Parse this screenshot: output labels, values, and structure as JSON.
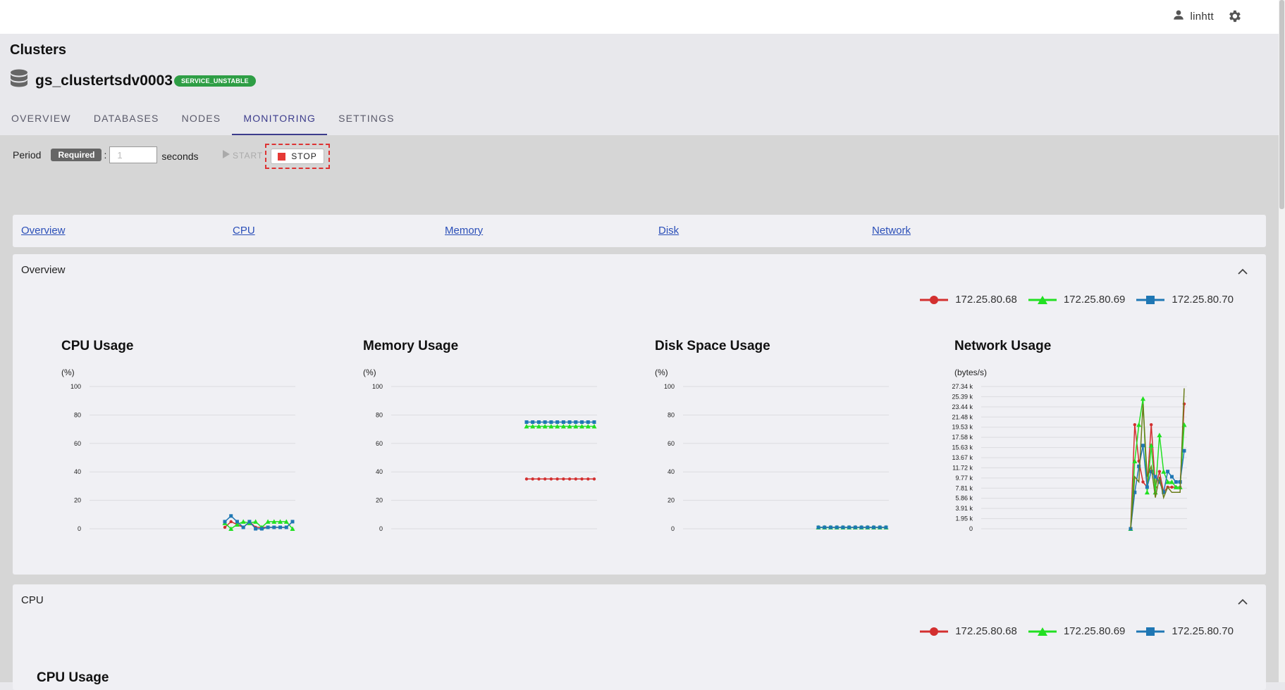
{
  "header": {
    "username": "linhtt",
    "user_icon": "person-icon",
    "settings_icon": "gear-icon"
  },
  "page_title": "Clusters",
  "cluster": {
    "name": "gs_clustertsdv0003",
    "status": "SERVICE_UNSTABLE",
    "icon": "database-icon",
    "status_color": "#2e9e45"
  },
  "tabs": [
    {
      "label": "OVERVIEW"
    },
    {
      "label": "DATABASES"
    },
    {
      "label": "NODES"
    },
    {
      "label": "MONITORING",
      "active": true
    },
    {
      "label": "SETTINGS"
    }
  ],
  "controls": {
    "period_label": "Period",
    "required_badge": "Required",
    "colon": ":",
    "period_value": "1",
    "seconds_label": "seconds",
    "start_label": "START",
    "stop_label": "STOP"
  },
  "nav_links": [
    "Overview",
    "CPU",
    "Memory",
    "Disk",
    "Network"
  ],
  "sections": {
    "overview_title": "Overview",
    "cpu_title": "CPU",
    "cpu_chart_title": "CPU Usage"
  },
  "legend": [
    {
      "label": "172.25.80.68",
      "color": "#d32f2f",
      "marker": "circle"
    },
    {
      "label": "172.25.80.69",
      "color": "#22e022",
      "marker": "triangle"
    },
    {
      "label": "172.25.80.70",
      "color": "#1f77b4",
      "marker": "square"
    }
  ],
  "chart_data": [
    {
      "type": "line",
      "title": "CPU Usage",
      "ylabel": "(%)",
      "ylim": [
        0,
        100
      ],
      "yticks": [
        "100",
        "80",
        "60",
        "40",
        "20",
        "0"
      ],
      "x": [
        1,
        2,
        3,
        4,
        5,
        6,
        7,
        8,
        9,
        10,
        11,
        12
      ],
      "series": [
        {
          "name": "172.25.80.68",
          "values": [
            1,
            5,
            3,
            1,
            5,
            1,
            1,
            1,
            1,
            1,
            1,
            5
          ]
        },
        {
          "name": "172.25.80.69",
          "values": [
            4,
            0,
            3,
            5,
            4,
            5,
            1,
            5,
            5,
            5,
            5,
            0
          ]
        },
        {
          "name": "172.25.80.70",
          "values": [
            5,
            9,
            5,
            1,
            5,
            0,
            0,
            1,
            1,
            1,
            1,
            5
          ]
        }
      ]
    },
    {
      "type": "line",
      "title": "Memory Usage",
      "ylabel": "(%)",
      "ylim": [
        0,
        100
      ],
      "yticks": [
        "100",
        "80",
        "60",
        "40",
        "20",
        "0"
      ],
      "x": [
        1,
        2,
        3,
        4,
        5,
        6,
        7,
        8,
        9,
        10,
        11,
        12
      ],
      "series": [
        {
          "name": "172.25.80.68",
          "values": [
            35,
            35,
            35,
            35,
            35,
            35,
            35,
            35,
            35,
            35,
            35,
            35
          ]
        },
        {
          "name": "172.25.80.69",
          "values": [
            72,
            72,
            72,
            72,
            72,
            72,
            72,
            72,
            72,
            72,
            72,
            72
          ]
        },
        {
          "name": "172.25.80.70",
          "values": [
            75,
            75,
            75,
            75,
            75,
            75,
            75,
            75,
            75,
            75,
            75,
            75
          ]
        }
      ]
    },
    {
      "type": "line",
      "title": "Disk Space Usage",
      "ylabel": "(%)",
      "ylim": [
        0,
        100
      ],
      "yticks": [
        "100",
        "80",
        "60",
        "40",
        "20",
        "0"
      ],
      "x": [
        1,
        2,
        3,
        4,
        5,
        6,
        7,
        8,
        9,
        10,
        11,
        12
      ],
      "series": [
        {
          "name": "172.25.80.68",
          "values": [
            1,
            1,
            1,
            1,
            1,
            1,
            1,
            1,
            1,
            1,
            1,
            1
          ]
        },
        {
          "name": "172.25.80.69",
          "values": [
            1,
            1,
            1,
            1,
            1,
            1,
            1,
            1,
            1,
            1,
            1,
            1
          ]
        },
        {
          "name": "172.25.80.70",
          "values": [
            1,
            1,
            1,
            1,
            1,
            1,
            1,
            1,
            1,
            1,
            1,
            1
          ]
        }
      ]
    },
    {
      "type": "line",
      "title": "Network Usage",
      "ylabel": "(bytes/s)",
      "ylim": [
        0,
        27.34
      ],
      "yticks": [
        "27.34 k",
        "25.39 k",
        "23.44 k",
        "21.48 k",
        "19.53 k",
        "17.58 k",
        "15.63 k",
        "13.67 k",
        "11.72 k",
        "9.77 k",
        "7.81 k",
        "5.86 k",
        "3.91 k",
        "1.95 k",
        "0"
      ],
      "x": [
        1,
        2,
        3,
        4,
        5,
        6,
        7,
        8,
        9,
        10,
        11,
        12,
        13,
        14
      ],
      "series": [
        {
          "name": "172.25.80.68",
          "values": [
            0,
            20,
            13,
            9,
            8,
            20,
            8,
            11,
            7,
            8,
            8,
            8,
            8,
            24
          ]
        },
        {
          "name": "172.25.80.69",
          "values": [
            0,
            13,
            20,
            25,
            7,
            16,
            7,
            18,
            11,
            9,
            9,
            8,
            8,
            20
          ]
        },
        {
          "name": "172.25.80.70",
          "values": [
            0,
            7,
            12,
            16,
            8,
            11,
            10,
            9,
            7,
            11,
            10,
            9,
            9,
            15
          ]
        },
        {
          "name": "",
          "values": [
            0,
            10,
            9,
            24,
            10,
            12,
            6,
            10,
            6,
            8,
            7,
            7,
            7,
            27
          ]
        }
      ]
    }
  ]
}
